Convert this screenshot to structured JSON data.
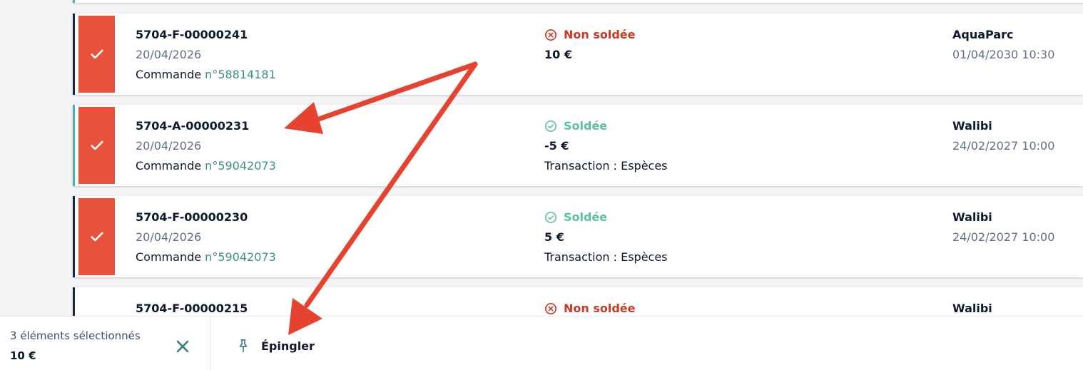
{
  "invoices": [
    {
      "reference": "5704-F-00000241",
      "date": "20/04/2026",
      "order_prefix": "Commande",
      "order_number": "n°58814181",
      "status": "Non soldée",
      "amount": "10 €",
      "transaction": "",
      "park": "AquaParc",
      "datetime": "01/04/2030 10:30"
    },
    {
      "reference": "5704-A-00000231",
      "date": "20/04/2026",
      "order_prefix": "Commande",
      "order_number": "n°59042073",
      "status": "Soldée",
      "amount": "-5 €",
      "transaction": "Transaction : Espèces",
      "park": "Walibi",
      "datetime": "24/02/2027 10:00"
    },
    {
      "reference": "5704-F-00000230",
      "date": "20/04/2026",
      "order_prefix": "Commande",
      "order_number": "n°59042073",
      "status": "Soldée",
      "amount": "5 €",
      "transaction": "Transaction : Espèces",
      "park": "Walibi",
      "datetime": "24/02/2027 10:00"
    },
    {
      "reference": "5704-F-00000215",
      "status": "Non soldée",
      "park": "Walibi"
    }
  ],
  "selection_bar": {
    "count_label": "3 éléments sélectionnés",
    "total": "10 €",
    "pin_label": "Épingler"
  },
  "colors": {
    "accent": "#e8513a",
    "unpaid": "#c83a24",
    "paid": "#5cc09a",
    "link": "#3b8f8a",
    "annotation_arrow": "#e5432f"
  },
  "icons": [
    "check-icon",
    "x-circle-icon",
    "check-circle-icon",
    "close-icon",
    "pin-icon"
  ]
}
